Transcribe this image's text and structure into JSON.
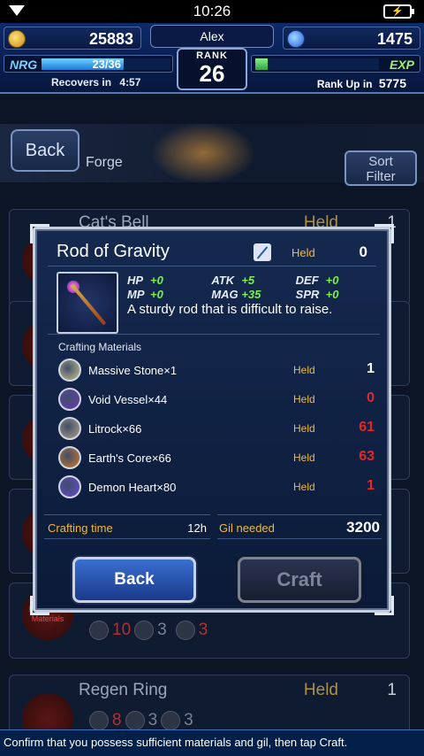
{
  "status": {
    "time": "10:26"
  },
  "header": {
    "gil": "25883",
    "gems": "1475",
    "player_name": "Alex",
    "rank_label": "RANK",
    "rank": "26",
    "nrg_label": "NRG",
    "nrg_value": "23/36",
    "nrg_fraction": 0.64,
    "recovers_label": "Recovers in",
    "recovers_time": "4:57",
    "exp_label": "EXP",
    "exp_fraction": 0.1,
    "rankup_label": "Rank Up in",
    "rankup_value": "5775"
  },
  "forge": {
    "back_label": "Back",
    "title": "Forge",
    "sort_label_1": "Sort",
    "sort_label_2": "Filter"
  },
  "background_list": [
    {
      "name": "Cat's Bell",
      "held": "Held",
      "count": "1"
    },
    {
      "name": "Regen Ring",
      "held": "Held",
      "count": "1"
    }
  ],
  "background_row": {
    "insufficient_label": "Insufficient Materials",
    "mat_counts": [
      "10",
      "3",
      "3"
    ],
    "regen_counts": [
      "8",
      "3",
      "3"
    ]
  },
  "modal": {
    "item_name": "Rod of Gravity",
    "held_label": "Held",
    "held_count": "0",
    "stats": [
      {
        "k": "HP",
        "v": "+0"
      },
      {
        "k": "ATK",
        "v": "+5"
      },
      {
        "k": "DEF",
        "v": "+0"
      },
      {
        "k": "MP",
        "v": "+0"
      },
      {
        "k": "MAG",
        "v": "+35"
      },
      {
        "k": "SPR",
        "v": "+0"
      }
    ],
    "description": "A sturdy rod that is difficult to raise.",
    "materials_label": "Crafting Materials",
    "materials": [
      {
        "name": "Massive Stone×1",
        "held": "Held",
        "count": "1",
        "ok": true,
        "color": "#c9c28e"
      },
      {
        "name": "Void Vessel×44",
        "held": "Held",
        "count": "0",
        "ok": false,
        "color": "#6a3ab8"
      },
      {
        "name": "Litrock×66",
        "held": "Held",
        "count": "61",
        "ok": false,
        "color": "#b0a288"
      },
      {
        "name": "Earth's Core×66",
        "held": "Held",
        "count": "63",
        "ok": false,
        "color": "#d07a2a"
      },
      {
        "name": "Demon Heart×80",
        "held": "Held",
        "count": "1",
        "ok": false,
        "color": "#6a4ad8"
      }
    ],
    "crafting_time_label": "Crafting time",
    "crafting_time": "12h",
    "gil_needed_label": "Gil needed",
    "gil_needed": "3200",
    "back_button": "Back",
    "craft_button": "Craft"
  },
  "footer": {
    "hint": "Confirm that you possess sufficient materials and gil, then tap Craft."
  },
  "colors": {
    "ok": "#ffffff",
    "insufficient": "#e02828",
    "held": "#f1b93a"
  }
}
